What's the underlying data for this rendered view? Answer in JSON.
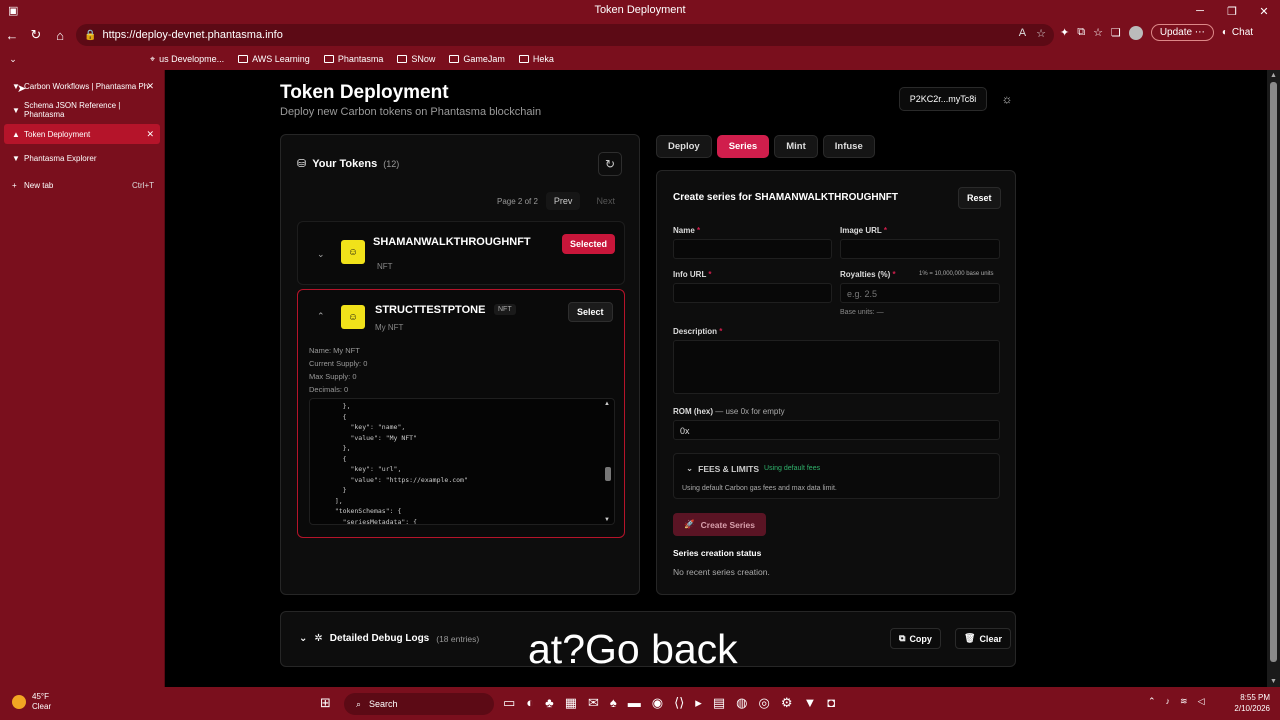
{
  "window": {
    "title": "Token Deployment"
  },
  "browser": {
    "url": "https://deploy-devnet.phantasma.info",
    "update_label": "Update",
    "chat_label": "Chat",
    "bookmarks": [
      "us Developme...",
      "AWS Learning",
      "Phantasma",
      "SNow",
      "GameJam",
      "Heka"
    ],
    "tabs": [
      {
        "label": "Carbon Workflows | Phantasma Ph"
      },
      {
        "label": "Schema JSON Reference | Phantasma"
      },
      {
        "label": "Token Deployment"
      },
      {
        "label": "Phantasma Explorer"
      }
    ],
    "new_tab": {
      "label": "New tab",
      "shortcut": "Ctrl+T"
    }
  },
  "page": {
    "title": "Token Deployment",
    "subtitle": "Deploy new Carbon tokens on Phantasma blockchain",
    "wallet": "P2KC2r...myTc8i"
  },
  "tokens": {
    "heading": "Your Tokens",
    "count": "(12)",
    "page_text": "Page 2 of 2",
    "prev_label": "Prev",
    "next_label": "Next",
    "token1": {
      "name": "SHAMANWALKTHROUGHNFT",
      "type": "NFT",
      "badge": "Selected"
    },
    "token2": {
      "name": "STRUCTTESTPTONE",
      "type": "NFT",
      "subtitle": "My NFT",
      "select_label": "Select",
      "meta_name": "Name: My NFT",
      "meta_current": "Current Supply: 0",
      "meta_max": "Max Supply: 0",
      "meta_decimals": "Decimals: 0",
      "code": "    },\n    {\n      \"key\": \"name\",\n      \"value\": \"My NFT\"\n    },\n    {\n      \"key\": \"url\",\n      \"value\": \"https://example.com\"\n    }\n  ],\n  \"tokenSchemas\": {\n    \"seriesMetadata\": {"
    }
  },
  "tabs": [
    "Deploy",
    "Series",
    "Mint",
    "Infuse"
  ],
  "series": {
    "title": "Create series for SHAMANWALKTHROUGHNFT",
    "reset_label": "Reset",
    "name_label": "Name",
    "image_url_label": "Image URL",
    "info_url_label": "Info URL",
    "royalties_label": "Royalties (%)",
    "royalties_hint": "1% = 10,000,000 base units",
    "royalties_placeholder": "e.g. 2.5",
    "base_units": "Base units: —",
    "description_label": "Description",
    "rom_label": "ROM (hex)",
    "rom_note": "— use 0x for empty",
    "rom_value": "0x",
    "fees_title": "FEES & LIMITS",
    "fees_status": "Using default fees",
    "fees_desc": "Using default Carbon gas fees and max data limit.",
    "create_label": "Create Series",
    "status_title": "Series creation status",
    "status_text": "No recent series creation."
  },
  "debug": {
    "title": "Detailed Debug Logs",
    "entries": "(18 entries)",
    "copy_label": "Copy",
    "clear_label": "Clear"
  },
  "caption": "at?Go back",
  "taskbar": {
    "temp": "45°F",
    "weather": "Clear",
    "search": "Search",
    "time": "8:55 PM",
    "date": "2/10/2026"
  },
  "colors": {
    "accent": "#d01e4c",
    "chrome": "#7a0f1d",
    "success": "#2fb26b"
  }
}
